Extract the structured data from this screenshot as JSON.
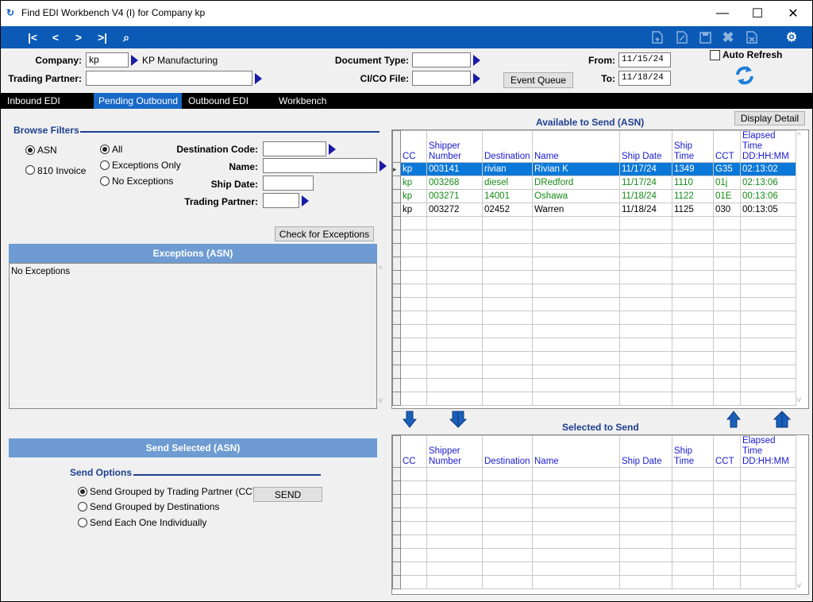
{
  "window": {
    "title": "Find EDI Workbench V4 (I) for Company kp",
    "minimize": "—",
    "maximize": "☐",
    "close": "✕"
  },
  "toolbar": {
    "first": "|<",
    "prev": "<",
    "next": ">",
    "last": ">|",
    "find": "⌕"
  },
  "header": {
    "company_label": "Company:",
    "company_value": "kp",
    "company_name": "KP Manufacturing",
    "trading_partner_label": "Trading Partner:",
    "trading_partner_value": "",
    "document_type_label": "Document Type:",
    "document_type_value": "",
    "cico_label": "CI/CO File:",
    "cico_value": "",
    "event_queue": "Event Queue",
    "from_label": "From:",
    "from_value": "11/15/24",
    "to_label": "To:",
    "to_value": "11/18/24",
    "auto_refresh": "Auto Refresh"
  },
  "tabs": [
    "Inbound EDI",
    "Pending Outbound",
    "Outbound EDI",
    "Workbench"
  ],
  "filters": {
    "title": "Browse Filters",
    "asn": "ASN",
    "inv810": "810 Invoice",
    "all": "All",
    "exceptions_only": "Exceptions Only",
    "no_exceptions": "No Exceptions",
    "destination_code_label": "Destination Code:",
    "name_label": "Name:",
    "ship_date_label": "Ship Date:",
    "trading_partner_label": "Trading Partner:",
    "check_exceptions": "Check for Exceptions"
  },
  "exceptions": {
    "title": "Exceptions (ASN)",
    "text": "No Exceptions"
  },
  "send": {
    "band": "Send Selected (ASN)",
    "options_title": "Send Options",
    "opt1": "Send Grouped by Trading Partner (CCT)",
    "opt2": "Send Grouped by Destinations",
    "opt3": "Send Each One Individually",
    "send_button": "SEND"
  },
  "available": {
    "title": "Available to Send  (ASN)",
    "display_detail": "Display Detail",
    "columns": [
      "CC",
      "Shipper Number",
      "Destination",
      "Name",
      "Ship Date",
      "Ship Time",
      "CCT",
      "Elapsed Time DD:HH:MM"
    ],
    "rows": [
      [
        "kp",
        "003141",
        "rivian",
        "Rivian K",
        "11/17/24",
        "1349",
        "G35",
        "02:13:02"
      ],
      [
        "kp",
        "003268",
        "diesel",
        "DRedford",
        "11/17/24",
        "1110",
        "01j",
        "02:13:06"
      ],
      [
        "kp",
        "003271",
        "14001",
        "Oshawa",
        "11/18/24",
        "1122",
        "01E",
        "00:13:06"
      ],
      [
        "kp",
        "003272",
        "02452",
        "Warren",
        "11/18/24",
        "1125",
        "030",
        "00:13:05"
      ]
    ]
  },
  "selected": {
    "title": "Selected to Send",
    "columns": [
      "CC",
      "Shipper Number",
      "Destination",
      "Name",
      "Ship Date",
      "Ship Time",
      "CCT",
      "Elapsed Time DD:HH:MM"
    ]
  }
}
